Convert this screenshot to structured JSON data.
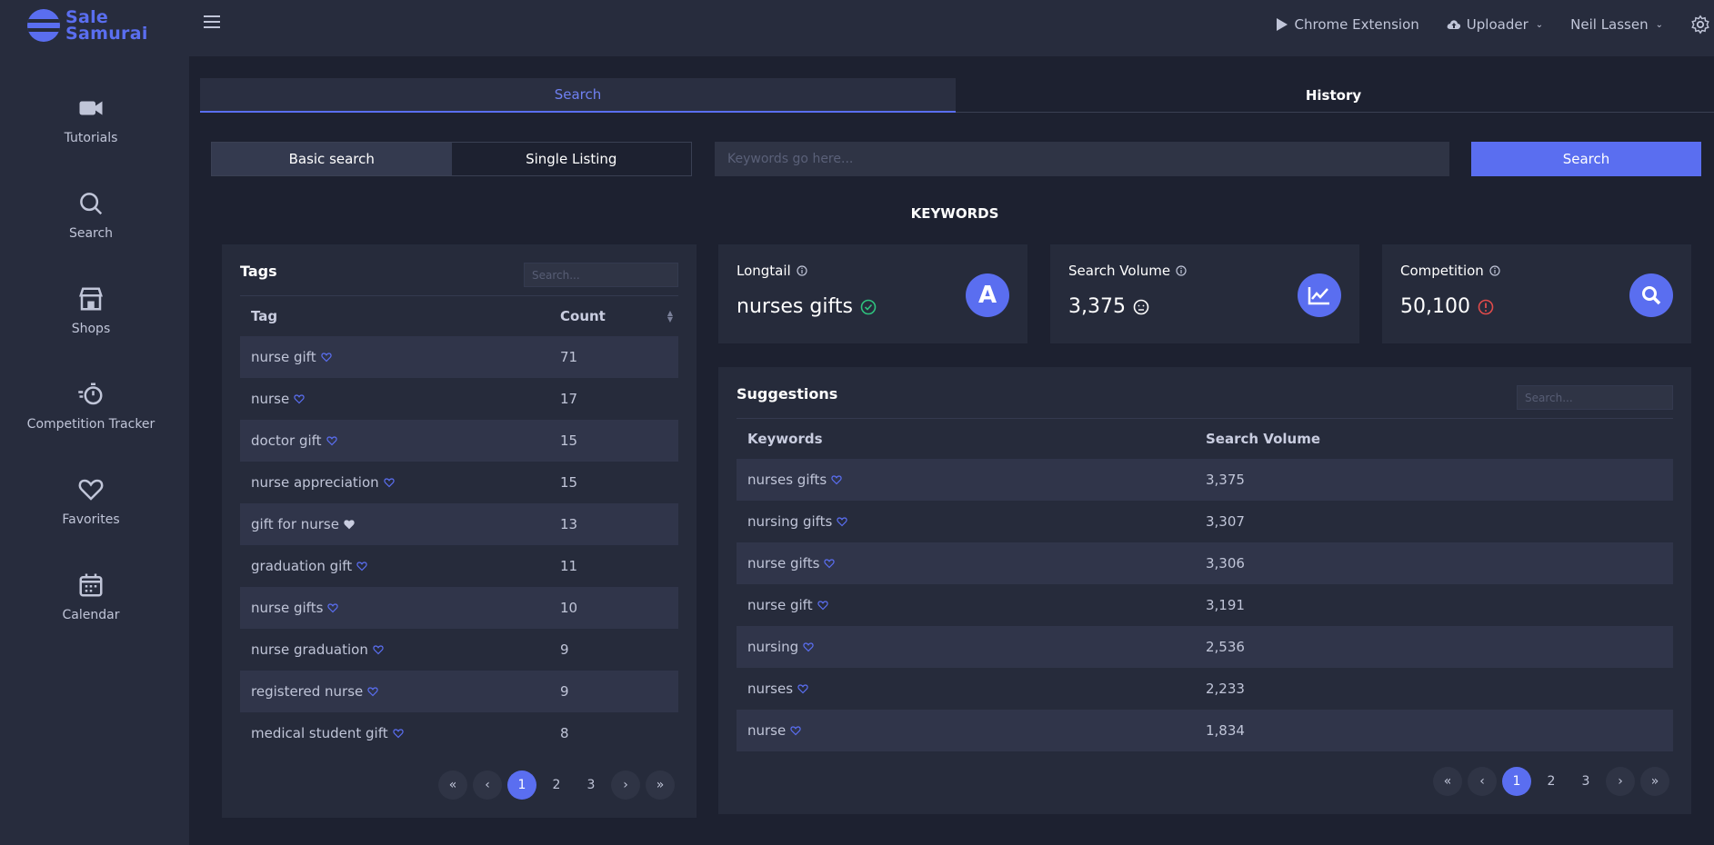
{
  "brand": {
    "line1": "Sale",
    "line2": "Samurai"
  },
  "sidebar": {
    "items": [
      {
        "label": "Tutorials",
        "icon": "video-camera-icon"
      },
      {
        "label": "Search",
        "icon": "search-icon"
      },
      {
        "label": "Shops",
        "icon": "shop-icon"
      },
      {
        "label": "Competition Tracker",
        "icon": "stopwatch-icon"
      },
      {
        "label": "Favorites",
        "icon": "heart-icon"
      },
      {
        "label": "Calendar",
        "icon": "calendar-icon"
      }
    ]
  },
  "topbar": {
    "chrome_extension": "Chrome Extension",
    "uploader": "Uploader",
    "user": "Neil Lassen"
  },
  "tabs": {
    "search": "Search",
    "history": "History"
  },
  "search_bar": {
    "basic": "Basic search",
    "single": "Single Listing",
    "placeholder": "Keywords go here...",
    "button": "Search"
  },
  "keywords_title": "KEYWORDS",
  "tags_panel": {
    "title": "Tags",
    "search_placeholder": "Search...",
    "col_tag": "Tag",
    "col_count": "Count",
    "rows": [
      {
        "tag": "nurse gift",
        "count": "71",
        "fav": false
      },
      {
        "tag": "nurse",
        "count": "17",
        "fav": false
      },
      {
        "tag": "doctor gift",
        "count": "15",
        "fav": false
      },
      {
        "tag": "nurse appreciation",
        "count": "15",
        "fav": false
      },
      {
        "tag": "gift for nurse",
        "count": "13",
        "fav": true
      },
      {
        "tag": "graduation gift",
        "count": "11",
        "fav": false
      },
      {
        "tag": "nurse gifts",
        "count": "10",
        "fav": false
      },
      {
        "tag": "nurse graduation",
        "count": "9",
        "fav": false
      },
      {
        "tag": "registered nurse",
        "count": "9",
        "fav": false
      },
      {
        "tag": "medical student gift",
        "count": "8",
        "fav": false
      }
    ],
    "pager": [
      "«",
      "‹",
      "1",
      "2",
      "3",
      "›",
      "»"
    ],
    "current_page": "1"
  },
  "stats": {
    "longtail": {
      "label": "Longtail",
      "value": "nurses gifts",
      "letter": "A"
    },
    "volume": {
      "label": "Search Volume",
      "value": "3,375"
    },
    "competition": {
      "label": "Competition",
      "value": "50,100"
    }
  },
  "colors": {
    "accent": "#5a6ef0",
    "good": "#2ec27e",
    "bad": "#e04b4b"
  },
  "suggestions": {
    "title": "Suggestions",
    "search_placeholder": "Search...",
    "col_keywords": "Keywords",
    "col_volume": "Search Volume",
    "rows": [
      {
        "keyword": "nurses gifts",
        "volume": "3,375"
      },
      {
        "keyword": "nursing gifts",
        "volume": "3,307"
      },
      {
        "keyword": "nurse gifts",
        "volume": "3,306"
      },
      {
        "keyword": "nurse gift",
        "volume": "3,191"
      },
      {
        "keyword": "nursing",
        "volume": "2,536"
      },
      {
        "keyword": "nurses",
        "volume": "2,233"
      },
      {
        "keyword": "nurse",
        "volume": "1,834"
      }
    ],
    "pager": [
      "«",
      "‹",
      "1",
      "2",
      "3",
      "›",
      "»"
    ],
    "current_page": "1"
  }
}
